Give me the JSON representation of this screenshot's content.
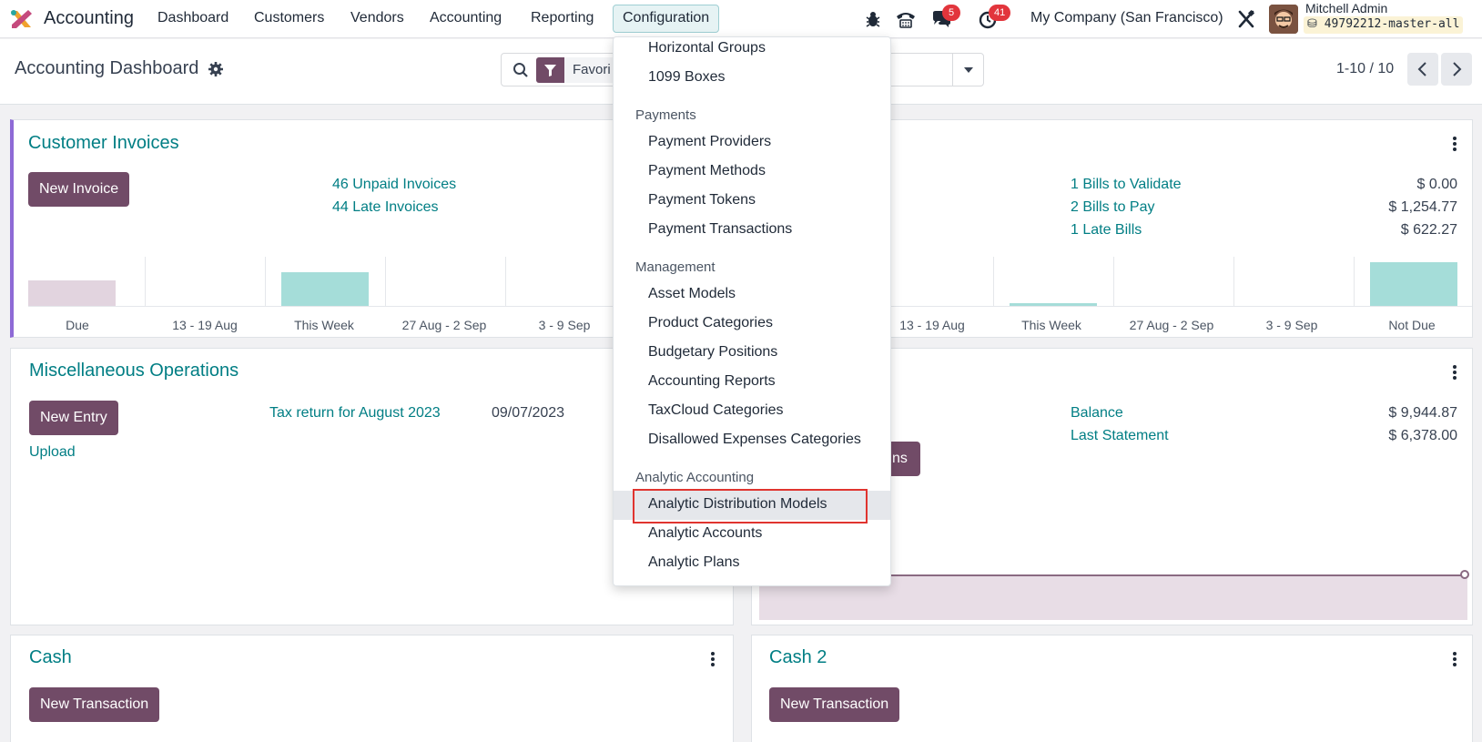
{
  "navbar": {
    "app_name": "Accounting",
    "menu": [
      "Dashboard",
      "Customers",
      "Vendors",
      "Accounting",
      "Reporting",
      "Configuration"
    ],
    "messages_badge": "5",
    "activities_badge": "41",
    "company": "My Company (San Francisco)",
    "user_name": "Mitchell Admin",
    "database": "49792212-master-all",
    "icons": [
      "app-logo",
      "bug-icon",
      "phone-icon",
      "chat-icon",
      "clock-icon",
      "tools-icon"
    ]
  },
  "control_panel": {
    "title": "Accounting Dashboard",
    "search_facet": "Favori",
    "pager": "1-10 / 10"
  },
  "dropdown": {
    "items_top": [
      "Horizontal Groups",
      "1099 Boxes"
    ],
    "payments_header": "Payments",
    "payments": [
      "Payment Providers",
      "Payment Methods",
      "Payment Tokens",
      "Payment Transactions"
    ],
    "management_header": "Management",
    "management": [
      "Asset Models",
      "Product Categories",
      "Budgetary Positions",
      "Accounting Reports",
      "TaxCloud Categories",
      "Disallowed Expenses Categories"
    ],
    "analytic_header": "Analytic Accounting",
    "analytic": [
      "Analytic Distribution Models",
      "Analytic Accounts",
      "Analytic Plans"
    ],
    "highlighted": "Analytic Distribution Models"
  },
  "customer_invoices": {
    "title": "Customer Invoices",
    "button": "New Invoice",
    "links": [
      "46 Unpaid Invoices",
      "44 Late Invoices"
    ],
    "chart_ticks": [
      "Due",
      "13 - 19 Aug",
      "This Week",
      "27 Aug - 2 Sep",
      "3 - 9 Sep"
    ],
    "accent": "#8e6ad6"
  },
  "vendor_bills": {
    "links": [
      "1 Bills to Validate",
      "2 Bills to Pay",
      "1 Late Bills"
    ],
    "amounts": [
      "$ 0.00",
      "$ 1,254.77",
      "$ 622.27"
    ],
    "chart_ticks": [
      "13 - 19 Aug",
      "This Week",
      "27 Aug - 2 Sep",
      "3 - 9 Sep",
      "Not Due"
    ]
  },
  "misc_operations": {
    "title": "Miscellaneous Operations",
    "button": "New Entry",
    "upload": "Upload",
    "entry_link": "Tax return for August 2023",
    "entry_date": "09/07/2023"
  },
  "bank": {
    "button_fragment": "ns",
    "labels": [
      "Balance",
      "Last Statement"
    ],
    "amounts": [
      "$ 9,944.87",
      "$ 6,378.00"
    ]
  },
  "cash": {
    "title": "Cash",
    "button": "New Transaction"
  },
  "cash2": {
    "title": "Cash 2",
    "button": "New Transaction"
  },
  "colors": {
    "brand": "#714b67",
    "link": "#017e84",
    "bar_past": "#e2d4df",
    "bar_future": "#a5ddd9",
    "highlight_outline": "#e0342f"
  }
}
